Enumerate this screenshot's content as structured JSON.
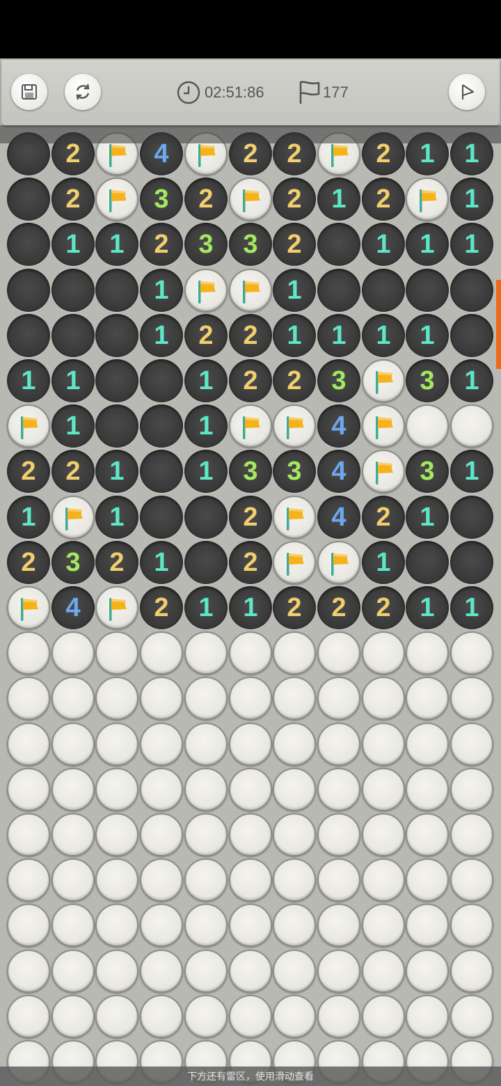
{
  "header": {
    "timer": "02:51:86",
    "flags_remaining": "177",
    "save_icon": "save-icon",
    "restart_icon": "restart-icon",
    "play_icon": "play-icon"
  },
  "colors": {
    "1": "#5ee6c8",
    "2": "#f2cf6e",
    "3": "#a3e860",
    "4": "#6da9f0",
    "flag": "#f5b21a",
    "flagpole": "#3cab98"
  },
  "board": {
    "rows": [
      [
        "O",
        "2",
        "F",
        "4",
        "F",
        "2",
        "2",
        "F",
        "2",
        "1",
        "1"
      ],
      [
        "O",
        "2",
        "F",
        "3",
        "2",
        "F",
        "2",
        "1",
        "2",
        "F",
        "1"
      ],
      [
        "O",
        "1",
        "1",
        "2",
        "3",
        "3",
        "2",
        "O",
        "1",
        "1",
        "1"
      ],
      [
        "O",
        "O",
        "O",
        "1",
        "F",
        "F",
        "1",
        "O",
        "O",
        "O",
        "O"
      ],
      [
        "O",
        "O",
        "O",
        "1",
        "2",
        "2",
        "1",
        "1",
        "1",
        "1",
        "O"
      ],
      [
        "1",
        "1",
        "O",
        "O",
        "1",
        "2",
        "2",
        "3",
        "F",
        "3",
        "1"
      ],
      [
        "F",
        "1",
        "O",
        "O",
        "1",
        "F",
        "F",
        "4",
        "F",
        "C",
        "C"
      ],
      [
        "2",
        "2",
        "1",
        "O",
        "1",
        "3",
        "3",
        "4",
        "F",
        "3",
        "1"
      ],
      [
        "1",
        "F",
        "1",
        "O",
        "O",
        "2",
        "F",
        "4",
        "2",
        "1",
        "O"
      ],
      [
        "2",
        "3",
        "2",
        "1",
        "O",
        "2",
        "F",
        "F",
        "1",
        "O",
        "O"
      ],
      [
        "F",
        "4",
        "F",
        "2",
        "1",
        "1",
        "2",
        "2",
        "2",
        "1",
        "1"
      ],
      [
        "C",
        "C",
        "C",
        "C",
        "C",
        "C",
        "C",
        "C",
        "C",
        "C",
        "C"
      ],
      [
        "C",
        "C",
        "C",
        "C",
        "C",
        "C",
        "C",
        "C",
        "C",
        "C",
        "C"
      ],
      [
        "C",
        "C",
        "C",
        "C",
        "C",
        "C",
        "C",
        "C",
        "C",
        "C",
        "C"
      ],
      [
        "C",
        "C",
        "C",
        "C",
        "C",
        "C",
        "C",
        "C",
        "C",
        "C",
        "C"
      ],
      [
        "C",
        "C",
        "C",
        "C",
        "C",
        "C",
        "C",
        "C",
        "C",
        "C",
        "C"
      ],
      [
        "C",
        "C",
        "C",
        "C",
        "C",
        "C",
        "C",
        "C",
        "C",
        "C",
        "C"
      ],
      [
        "C",
        "C",
        "C",
        "C",
        "C",
        "C",
        "C",
        "C",
        "C",
        "C",
        "C"
      ],
      [
        "C",
        "C",
        "C",
        "C",
        "C",
        "C",
        "C",
        "C",
        "C",
        "C",
        "C"
      ],
      [
        "C",
        "C",
        "C",
        "C",
        "C",
        "C",
        "C",
        "C",
        "C",
        "C",
        "C"
      ],
      [
        "C",
        "C",
        "C",
        "C",
        "C",
        "C",
        "C",
        "C",
        "C",
        "C",
        "C"
      ]
    ]
  },
  "footer": {
    "hint": "下方还有雷区，使用滑动查看"
  }
}
